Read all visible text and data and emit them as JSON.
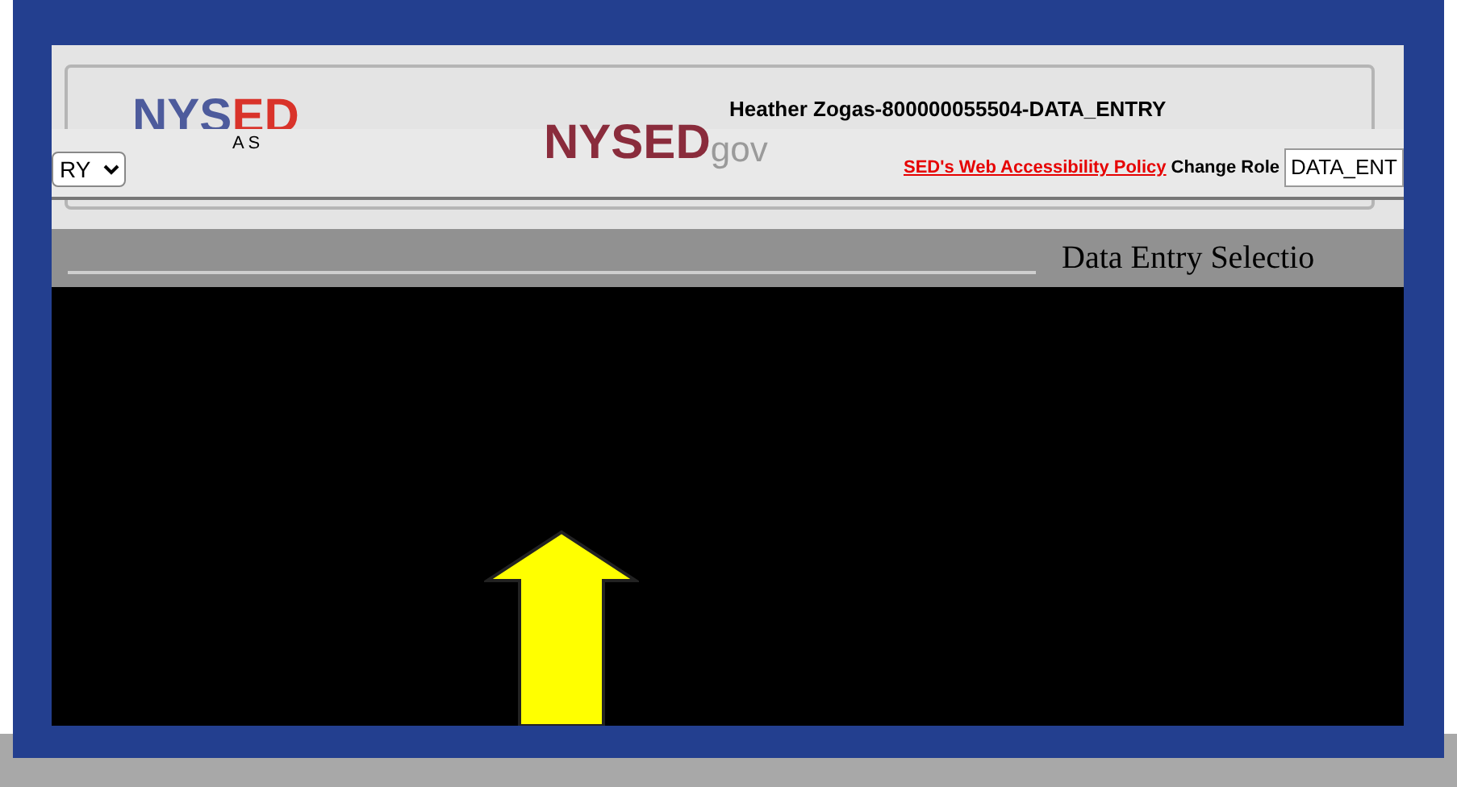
{
  "header": {
    "logo": {
      "left": "NYS",
      "right": "ED"
    },
    "user": "Heather Zogas-800000055504-DATA_ENTRY",
    "app_label": "A S",
    "role_select": {
      "value": "RY"
    },
    "gov_logo": {
      "mark": "NYSED",
      "suffix": "gov"
    },
    "accessibility_link": "SED's Web Accessibility Policy",
    "change_role": {
      "label": "Change Role",
      "value": "DATA_ENT"
    }
  },
  "page_title": "Data Entry Selectio",
  "annotation": {
    "kind": "up-arrow"
  }
}
